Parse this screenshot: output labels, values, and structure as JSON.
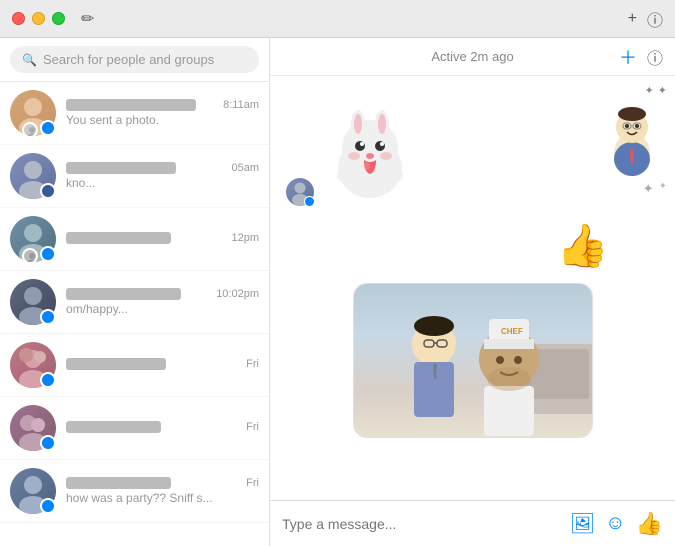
{
  "titleBar": {
    "trafficLights": [
      "red",
      "yellow",
      "green"
    ],
    "composeIcon": "✏",
    "plusIcon": "+",
    "infoIcon": "ⓘ"
  },
  "sidebar": {
    "searchPlaceholder": "Search for people and groups",
    "conversations": [
      {
        "id": 1,
        "avatarColor": "#c8a080",
        "time": "8:11am",
        "preview": "You sent a photo.",
        "badge": "messenger",
        "hasSubAvatar": true
      },
      {
        "id": 2,
        "avatarColor": "#8090b0",
        "time": "05am",
        "preview": "kno...",
        "badge": "fb"
      },
      {
        "id": 3,
        "avatarColor": "#7090a0",
        "time": "12pm",
        "preview": "",
        "badge": "messenger",
        "hasSubAvatar": true
      },
      {
        "id": 4,
        "avatarColor": "#506080",
        "time": "10:02pm",
        "preview": "om/happy...",
        "badge": "messenger"
      },
      {
        "id": 5,
        "avatarColor": "#c08090",
        "time": "Fri",
        "preview": "",
        "badge": "messenger"
      },
      {
        "id": 6,
        "avatarColor": "#a07090",
        "time": "Fri",
        "preview": "",
        "badge": "messenger"
      },
      {
        "id": 7,
        "avatarColor": "#708090",
        "time": "Fri",
        "preview": "how was a party?? Sniff s...",
        "badge": "messenger"
      }
    ]
  },
  "chat": {
    "statusText": "Active 2m ago",
    "inputPlaceholder": "Type a message...",
    "addPhotoIcon": "🖼",
    "emojiIcon": "☺",
    "likeIcon": "👍"
  }
}
